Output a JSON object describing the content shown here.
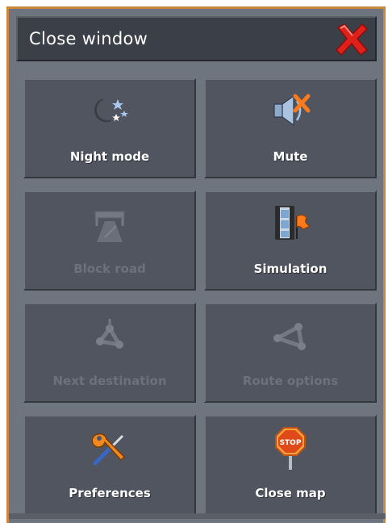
{
  "window": {
    "close_label": "Close window"
  },
  "icons": {
    "close": "close-icon",
    "night": "moon-stars-icon",
    "mute": "speaker-muted-icon",
    "block": "road-block-icon",
    "simulation": "film-flag-icon",
    "next_destination": "route-waypoint-icon",
    "route_options": "route-options-icon",
    "preferences": "wrench-screwdriver-icon",
    "close_map": "stop-sign-icon"
  },
  "colors": {
    "frame_border": "#c8893e",
    "panel": "#6f757f",
    "tile": "#505560",
    "disabled_text": "#6c717b",
    "close_red": "#e0201a"
  },
  "menu": {
    "night_mode": "Night mode",
    "mute": "Mute",
    "block_road": "Block road",
    "simulation": "Simulation",
    "next_destination": "Next destination",
    "route_options": "Route options",
    "preferences": "Preferences",
    "close_map": "Close map"
  }
}
